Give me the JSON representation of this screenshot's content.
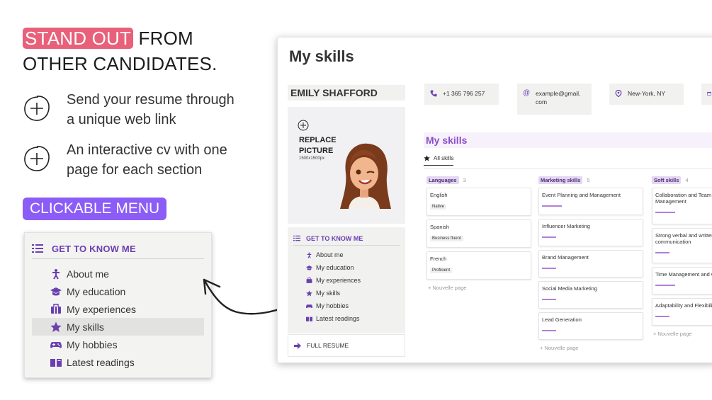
{
  "headline": {
    "highlight": "STAND OUT",
    "rest1": " FROM",
    "line2": "OTHER CANDIDATES."
  },
  "features": [
    {
      "text": "Send your resume through a unique web link"
    },
    {
      "text": "An interactive cv with one page for each section"
    }
  ],
  "menu_tag": "CLICKABLE MENU",
  "big_menu": {
    "header": "GET TO KNOW ME",
    "items": [
      {
        "label": "About me",
        "icon": "person-icon"
      },
      {
        "label": "My education",
        "icon": "graduation-cap-icon"
      },
      {
        "label": "My experiences",
        "icon": "briefcase-icon"
      },
      {
        "label": "My skills",
        "icon": "star-icon",
        "active": true
      },
      {
        "label": "My hobbies",
        "icon": "gamepad-icon"
      },
      {
        "label": "Latest readings",
        "icon": "book-icon"
      }
    ]
  },
  "window": {
    "page_title": "My skills",
    "name": "EMILY SHAFFORD",
    "photo": {
      "replace1": "REPLACE",
      "replace2": "PICTURE",
      "dims": "1500x1500px"
    },
    "side_menu": {
      "header": "GET TO KNOW ME",
      "items": [
        {
          "label": "About me"
        },
        {
          "label": "My education"
        },
        {
          "label": "My experiences"
        },
        {
          "label": "My skills"
        },
        {
          "label": "My hobbies"
        },
        {
          "label": "Latest readings"
        }
      ]
    },
    "full_resume": "FULL RESUME",
    "contacts": {
      "phone": "+1 365 796 257",
      "email1": "example@gmail.",
      "email2": "com",
      "location": "New-York, NY"
    },
    "section_title": "My skills",
    "tab": "All skills",
    "columns": [
      {
        "name": "Languages",
        "count": "3",
        "cards": [
          {
            "title": "English",
            "tag": "Native"
          },
          {
            "title": "Spanish",
            "tag": "Business fluent"
          },
          {
            "title": "French",
            "tag": "Proficient"
          }
        ],
        "new_page": "+ Nouvelle page"
      },
      {
        "name": "Marketing skills",
        "count": "5",
        "cards": [
          {
            "title": "Event Planning and Management"
          },
          {
            "title": "Influencer Marketing"
          },
          {
            "title": "Brand Management"
          },
          {
            "title": "Social Media Marketing"
          },
          {
            "title": "Lead Generation"
          }
        ],
        "new_page": "+ Nouvelle page"
      },
      {
        "name": "Soft skills",
        "count": "4",
        "cards": [
          {
            "title": "Collaboration and Team Management"
          },
          {
            "title": "Strong verbal and written communication"
          },
          {
            "title": "Time Management and Organization"
          },
          {
            "title": "Adaptability and Flexibility"
          }
        ],
        "new_page": "+ Nouvelle page"
      }
    ]
  },
  "colors": {
    "pink": "#e8607a",
    "purple": "#8b5cf6",
    "menu_purple": "#6b3fb0",
    "bar": "#b47fd8"
  }
}
